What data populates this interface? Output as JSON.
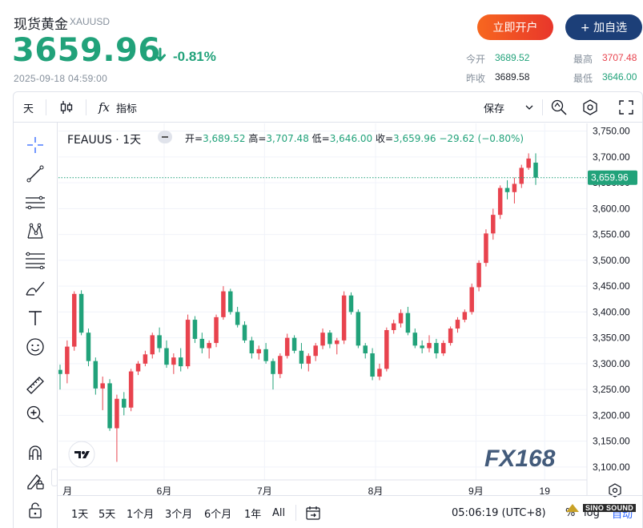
{
  "quote": {
    "name": "现货黄金",
    "code": "XAUUSD",
    "price": "3659.96",
    "change_pct": "-0.81%",
    "timestamp": "2025-09-18 04:59:00",
    "stats": {
      "open_label": "今开",
      "open_value": "3689.52",
      "high_label": "最高",
      "high_value": "3707.48",
      "prev_close_label": "昨收",
      "prev_close_value": "3689.58",
      "low_label": "最低",
      "low_value": "3646.00"
    },
    "colors": {
      "down": "#21a27a",
      "up": "#e8434e",
      "brand": "#1c3f78"
    }
  },
  "buttons": {
    "open_account": "立即开户",
    "add_watchlist": "+ 加自选"
  },
  "toolbar": {
    "interval": "天",
    "indicators": "指标",
    "save": "保存",
    "icons": [
      "candles-icon",
      "fx-icon",
      "chevron-down-icon",
      "search-zoom-icon",
      "settings-icon",
      "fullscreen-icon"
    ]
  },
  "left_tools": [
    "crosshair-icon",
    "trend-line-icon",
    "parallel-lines-icon",
    "pattern-icon",
    "fib-icon",
    "brush-icon",
    "text-icon",
    "emoji-icon",
    "ruler-icon",
    "zoom-in-icon",
    "magnet-icon",
    "lock-pencil-icon",
    "lock-icon"
  ],
  "legend": {
    "symbol": "FEAUUS · 1天",
    "open_label": "开=",
    "open_value": "3,689.52",
    "high_label": "高=",
    "high_value": "3,707.48",
    "low_label": "低=",
    "low_value": "3,646.00",
    "close_label": "收=",
    "close_value": "3,659.96",
    "change": "−29.62 (−0.80%)"
  },
  "chart_data": {
    "type": "candlestick",
    "y_ticks": [
      "3,750.00",
      "3,700.00",
      "3,650.00",
      "3,600.00",
      "3,550.00",
      "3,500.00",
      "3,450.00",
      "3,400.00",
      "3,350.00",
      "3,300.00",
      "3,250.00",
      "3,200.00",
      "3,150.00",
      "3,100.00"
    ],
    "ylim": [
      3075,
      3765
    ],
    "x_ticks": [
      "月",
      "6月",
      "7月",
      "8月",
      "9月",
      "19"
    ],
    "last_price_label": "3,659.96",
    "last_price": 3659.96,
    "candles": [
      [
        3288,
        3298,
        3250,
        3280
      ],
      [
        3280,
        3345,
        3262,
        3333
      ],
      [
        3333,
        3440,
        3325,
        3435
      ],
      [
        3435,
        3442,
        3355,
        3360
      ],
      [
        3360,
        3368,
        3295,
        3305
      ],
      [
        3305,
        3312,
        3240,
        3252
      ],
      [
        3252,
        3275,
        3210,
        3262
      ],
      [
        3262,
        3270,
        3170,
        3175
      ],
      [
        3175,
        3240,
        3110,
        3232
      ],
      [
        3232,
        3245,
        3200,
        3215
      ],
      [
        3215,
        3290,
        3208,
        3285
      ],
      [
        3285,
        3305,
        3278,
        3300
      ],
      [
        3300,
        3325,
        3295,
        3318
      ],
      [
        3318,
        3360,
        3310,
        3355
      ],
      [
        3355,
        3370,
        3322,
        3330
      ],
      [
        3330,
        3345,
        3292,
        3298
      ],
      [
        3298,
        3320,
        3280,
        3312
      ],
      [
        3312,
        3330,
        3285,
        3295
      ],
      [
        3295,
        3395,
        3290,
        3385
      ],
      [
        3385,
        3392,
        3340,
        3348
      ],
      [
        3348,
        3360,
        3320,
        3330
      ],
      [
        3330,
        3345,
        3310,
        3340
      ],
      [
        3340,
        3395,
        3332,
        3390
      ],
      [
        3390,
        3450,
        3385,
        3440
      ],
      [
        3440,
        3445,
        3395,
        3400
      ],
      [
        3400,
        3410,
        3370,
        3375
      ],
      [
        3375,
        3382,
        3340,
        3345
      ],
      [
        3345,
        3352,
        3310,
        3320
      ],
      [
        3320,
        3335,
        3308,
        3328
      ],
      [
        3328,
        3340,
        3300,
        3305
      ],
      [
        3305,
        3310,
        3250,
        3280
      ],
      [
        3280,
        3320,
        3272,
        3315
      ],
      [
        3315,
        3358,
        3310,
        3350
      ],
      [
        3350,
        3355,
        3320,
        3325
      ],
      [
        3325,
        3340,
        3290,
        3300
      ],
      [
        3300,
        3320,
        3285,
        3315
      ],
      [
        3315,
        3340,
        3305,
        3335
      ],
      [
        3335,
        3368,
        3328,
        3360
      ],
      [
        3360,
        3365,
        3330,
        3338
      ],
      [
        3338,
        3350,
        3318,
        3345
      ],
      [
        3345,
        3440,
        3338,
        3432
      ],
      [
        3432,
        3438,
        3395,
        3400
      ],
      [
        3400,
        3405,
        3330,
        3335
      ],
      [
        3335,
        3340,
        3310,
        3320
      ],
      [
        3320,
        3330,
        3268,
        3275
      ],
      [
        3275,
        3300,
        3268,
        3290
      ],
      [
        3290,
        3370,
        3285,
        3365
      ],
      [
        3365,
        3385,
        3358,
        3378
      ],
      [
        3378,
        3405,
        3370,
        3398
      ],
      [
        3398,
        3410,
        3355,
        3360
      ],
      [
        3360,
        3368,
        3330,
        3335
      ],
      [
        3335,
        3345,
        3320,
        3330
      ],
      [
        3330,
        3355,
        3322,
        3340
      ],
      [
        3340,
        3348,
        3310,
        3320
      ],
      [
        3320,
        3345,
        3315,
        3340
      ],
      [
        3340,
        3372,
        3335,
        3368
      ],
      [
        3368,
        3390,
        3360,
        3385
      ],
      [
        3385,
        3405,
        3380,
        3400
      ],
      [
        3400,
        3455,
        3395,
        3448
      ],
      [
        3448,
        3500,
        3440,
        3495
      ],
      [
        3495,
        3560,
        3488,
        3552
      ],
      [
        3552,
        3600,
        3540,
        3588
      ],
      [
        3588,
        3645,
        3580,
        3640
      ],
      [
        3640,
        3655,
        3618,
        3632
      ],
      [
        3632,
        3660,
        3610,
        3648
      ],
      [
        3648,
        3685,
        3640,
        3679
      ],
      [
        3679,
        3707,
        3675,
        3697
      ],
      [
        3689,
        3707,
        3646,
        3660
      ]
    ]
  },
  "bottom_bar": {
    "ranges": [
      "1天",
      "5天",
      "1个月",
      "3个月",
      "6个月",
      "1年",
      "All"
    ],
    "clock": "05:06:19 (UTC+8)",
    "percent": "%",
    "log": "log",
    "auto": "自动"
  },
  "watermark": {
    "fx168": "FX168",
    "sino": "SINO SOUND"
  }
}
